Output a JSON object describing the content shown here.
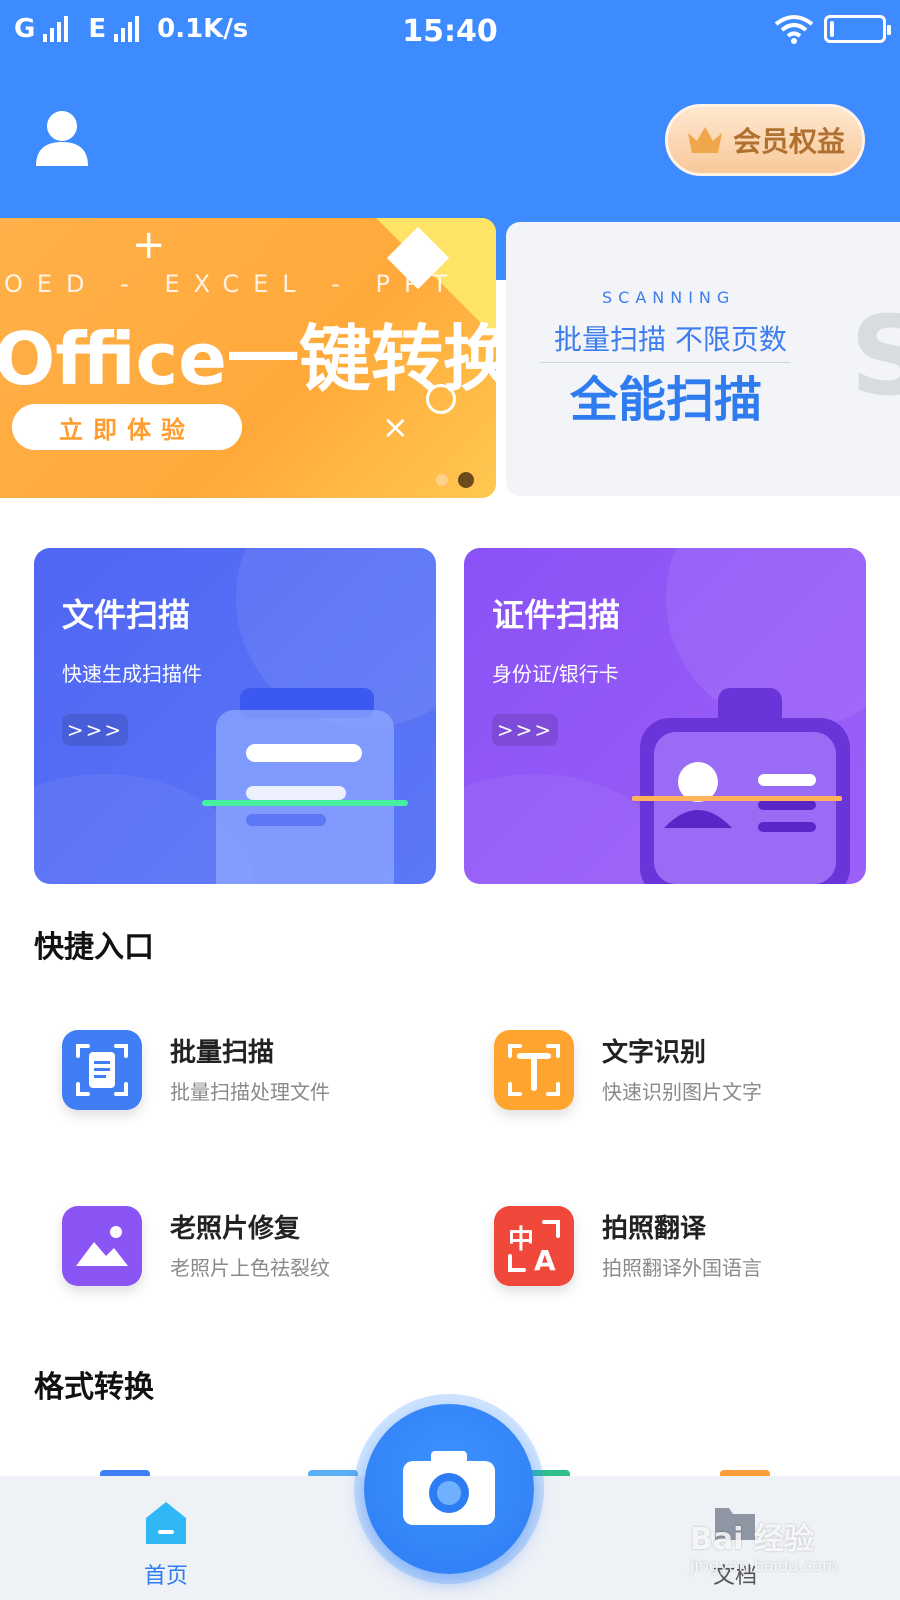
{
  "status_bar": {
    "carrier1": "G",
    "carrier2": "E",
    "speed": "0.1K/s",
    "time": "15:40"
  },
  "header": {
    "member_label": "会员权益"
  },
  "banner": {
    "subtitle": "OED - EXCEL - PPT",
    "title": "Office一键转换",
    "cta": "立即体验",
    "page_count": 2,
    "active_page": 2,
    "next_banner": {
      "en_label": "SCANNING",
      "line1": "批量扫描 不限页数",
      "title": "全能扫描",
      "letter": "S"
    }
  },
  "scan_cards": [
    {
      "title": "文件扫描",
      "subtitle": "快速生成扫描件",
      "arrow": ">>>"
    },
    {
      "title": "证件扫描",
      "subtitle": "身份证/银行卡",
      "arrow": ">>>"
    }
  ],
  "quick_section": {
    "title": "快捷入口",
    "items": [
      {
        "name": "批量扫描",
        "desc": "批量扫描处理文件",
        "icon": "batch-scan-icon",
        "color": "#3f7ef5"
      },
      {
        "name": "文字识别",
        "desc": "快速识别图片文字",
        "icon": "text-recognition-icon",
        "color": "#ffa52f"
      },
      {
        "name": "老照片修复",
        "desc": "老照片上色祛裂纹",
        "icon": "photo-restore-icon",
        "color": "#8b55f5"
      },
      {
        "name": "拍照翻译",
        "desc": "拍照翻译外国语言",
        "icon": "photo-translate-icon",
        "color": "#f0483a"
      }
    ]
  },
  "format_section": {
    "title": "格式转换"
  },
  "tab_bar": {
    "home": "首页",
    "docs": "文档"
  },
  "watermark": {
    "text": "Bai 经验",
    "url": "jingyan.baidu.com"
  },
  "colors": {
    "primary": "#3d8bff",
    "banner_orange": "#ffa93a",
    "doc_card": "#4f66f4",
    "id_card": "#8a52f6"
  }
}
